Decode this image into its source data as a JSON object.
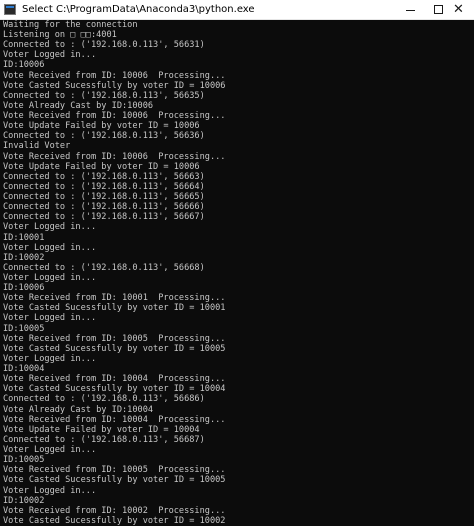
{
  "window": {
    "title": "Select C:\\ProgramData\\Anaconda3\\python.exe",
    "minimize_glyph": "minimize",
    "maximize_glyph": "maximize",
    "close_glyph": "✕",
    "icon": "console-app-icon"
  },
  "console": {
    "lines": [
      "Waiting for the connection",
      "Listening on □ □□:4001",
      "Connected to : ('192.168.0.113', 56631)",
      "Voter Logged in...",
      "ID:10006",
      "Vote Received from ID: 10006  Processing...",
      "Vote Casted Sucessfully by voter ID = 10006",
      "Connected to : ('192.168.0.113', 56635)",
      "Vote Already Cast by ID:10006",
      "Vote Received from ID: 10006  Processing...",
      "Vote Update Failed by voter ID = 10006",
      "Connected to : ('192.168.0.113', 56636)",
      "Invalid Voter",
      "Vote Received from ID: 10006  Processing...",
      "Vote Update Failed by voter ID = 10006",
      "Connected to : ('192.168.0.113', 56663)",
      "Connected to : ('192.168.0.113', 56664)",
      "Connected to : ('192.168.0.113', 56665)",
      "Connected to : ('192.168.0.113', 56666)",
      "Connected to : ('192.168.0.113', 56667)",
      "Voter Logged in...",
      "ID:10001",
      "Voter Logged in...",
      "ID:10002",
      "Connected to : ('192.168.0.113', 56668)",
      "Voter Logged in...",
      "ID:10006",
      "Vote Received from ID: 10001  Processing...",
      "Vote Casted Sucessfully by voter ID = 10001",
      "Voter Logged in...",
      "ID:10005",
      "Vote Received from ID: 10005  Processing...",
      "Vote Casted Sucessfully by voter ID = 10005",
      "Voter Logged in...",
      "ID:10004",
      "Vote Received from ID: 10004  Processing...",
      "Vote Casted Sucessfully by voter ID = 10004",
      "Connected to : ('192.168.0.113', 56686)",
      "Vote Already Cast by ID:10004",
      "Vote Received from ID: 10004  Processing...",
      "Vote Update Failed by voter ID = 10004",
      "Connected to : ('192.168.0.113', 56687)",
      "Voter Logged in...",
      "ID:10005",
      "Vote Received from ID: 10005  Processing...",
      "Vote Casted Sucessfully by voter ID = 10005",
      "Voter Logged in...",
      "ID:10002",
      "Vote Received from ID: 10002  Processing...",
      "Vote Casted Sucessfully by voter ID = 10002"
    ]
  },
  "colors": {
    "console_background": "#0c0c0c",
    "console_text": "#c7c7c7",
    "titlebar_background": "#ffffff"
  }
}
